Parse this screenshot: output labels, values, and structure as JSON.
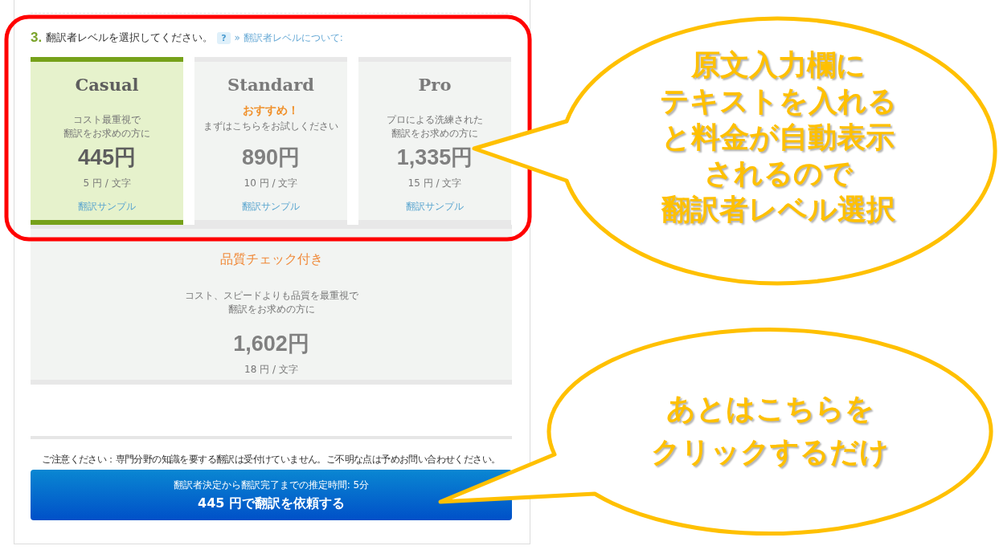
{
  "step": {
    "number": "3.",
    "title": "翻訳者レベルを選択してください。",
    "help": "?",
    "link": "» 翻訳者レベルについて:"
  },
  "levels": [
    {
      "name": "Casual",
      "description": [
        "コスト最重視で",
        "翻訳をお求めの方に"
      ],
      "price": "445円",
      "rate": "5 円 / 文字",
      "sample": "翻訳サンプル",
      "selected": true
    },
    {
      "name": "Standard",
      "recommend": "おすすめ！",
      "description": [
        "まずはこちらをお試しください"
      ],
      "price": "890円",
      "rate": "10 円 / 文字",
      "sample": "翻訳サンプル",
      "selected": false
    },
    {
      "name": "Pro",
      "description": [
        "プロによる洗練された",
        "翻訳をお求めの方に"
      ],
      "price": "1,335円",
      "rate": "15 円 / 文字",
      "sample": "翻訳サンプル",
      "selected": false
    }
  ],
  "premium": {
    "name": "品質チェック付き",
    "description": [
      "コスト、スピードよりも品質を最重視で",
      "翻訳をお求めの方に"
    ],
    "price": "1,602円",
    "rate": "18 円 / 文字",
    "selected": false
  },
  "notice": "ご注意ください：専門分野の知識を要する翻訳は受付けていません。ご不明な点は予めお問い合わせください。",
  "order_button": {
    "estimate": "翻訳者決定から翻訳完了までの推定時間:  5分",
    "label": "445 円で翻訳を依頼する"
  },
  "callouts": [
    {
      "lines": [
        "原文入力欄に",
        "テキストを入れる",
        "と料金が自動表示",
        "されるので",
        "翻訳者レベル選択"
      ]
    },
    {
      "lines": [
        "あとはこちらを",
        "クリックするだけ"
      ]
    }
  ]
}
